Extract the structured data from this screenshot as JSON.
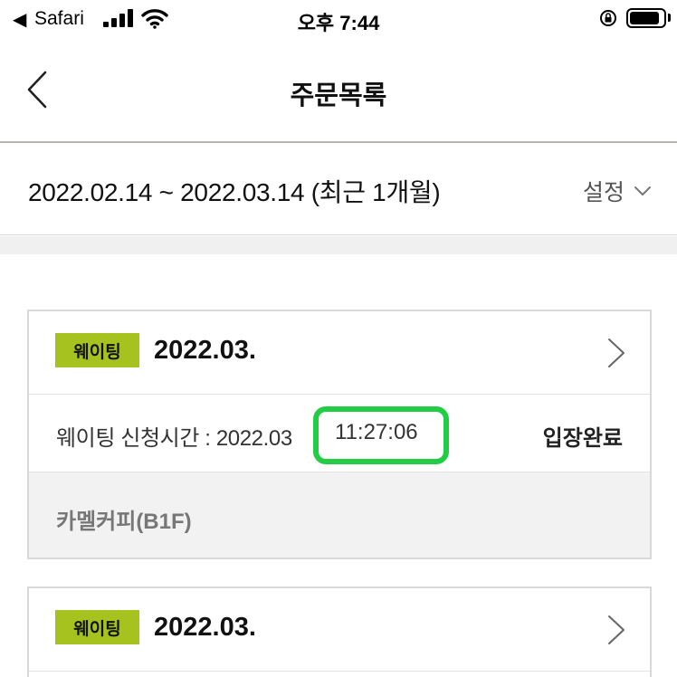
{
  "status_bar": {
    "back_app": "Safari",
    "time": "오후 7:44"
  },
  "nav": {
    "title": "주문목록"
  },
  "filter": {
    "range": "2022.02.14 ~ 2022.03.14 (최근 1개월)",
    "setting_label": "설정"
  },
  "orders": [
    {
      "badge": "웨이팅",
      "date": "2022.03.",
      "apply_label": "웨이팅 신청시간 : 2022.03",
      "apply_time": "11:27:06",
      "status": "입장완료",
      "store": "카멜커피(B1F)"
    },
    {
      "badge": "웨이팅",
      "date": "2022.03."
    }
  ],
  "colors": {
    "badge": "#a6c21f",
    "highlight": "#22cc44"
  },
  "icons": {
    "status_back": "back-triangle-icon",
    "signal": "signal-bars-icon",
    "wifi": "wifi-icon",
    "lock": "orientation-lock-icon",
    "battery": "battery-icon",
    "nav_back": "chevron-left-icon",
    "dropdown": "chevron-down-icon",
    "card_open": "chevron-right-icon"
  }
}
